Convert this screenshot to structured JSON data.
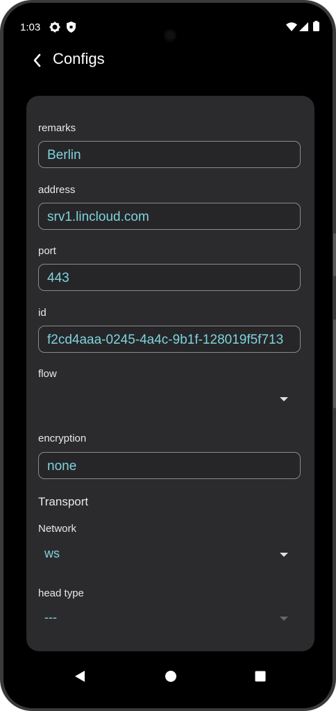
{
  "status": {
    "time": "1:03",
    "left_icons": [
      "gear-icon",
      "shield-icon"
    ],
    "right_icons": [
      "wifi-icon",
      "signal-icon",
      "battery-icon"
    ]
  },
  "appbar": {
    "title": "Configs",
    "back_icon": "back-arrow-icon"
  },
  "form": {
    "remarks": {
      "label": "remarks",
      "value": "Berlin"
    },
    "address": {
      "label": "address",
      "value": "srv1.lincloud.com"
    },
    "port": {
      "label": "port",
      "value": "443"
    },
    "id": {
      "label": "id",
      "value": "f2cd4aaa-0245-4a4c-9b1f-128019f5f713"
    },
    "flow": {
      "label": "flow",
      "value": ""
    },
    "encryption": {
      "label": "encryption",
      "value": "none"
    },
    "transport_heading": "Transport",
    "network": {
      "label": "Network",
      "value": "ws"
    },
    "head_type": {
      "label": "head type",
      "value": "---"
    }
  },
  "navbar": {
    "icons": [
      "back-triangle-icon",
      "home-circle-icon",
      "recents-square-icon"
    ]
  },
  "colors": {
    "value_text": "#7fd3de",
    "card_bg": "#2b2b2d",
    "screen_bg": "#000000"
  }
}
